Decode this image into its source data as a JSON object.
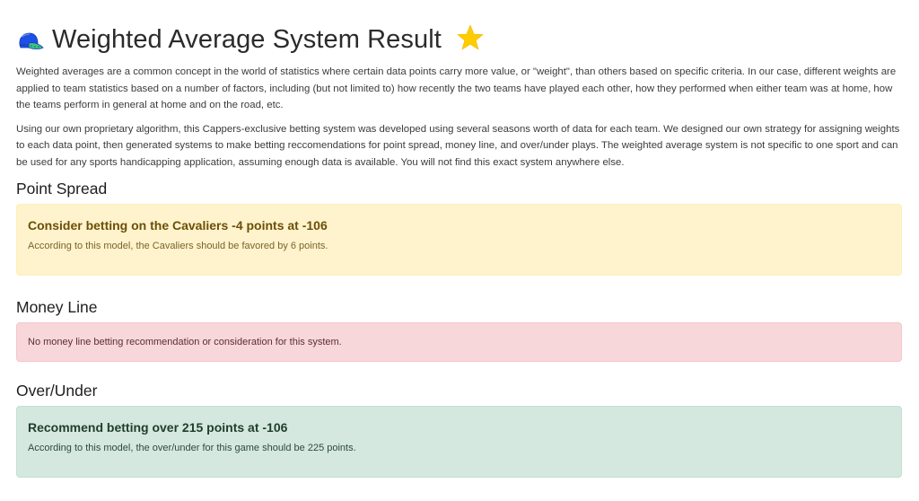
{
  "header": {
    "title": "Weighted Average System Result",
    "leading_icon": "baseball-cap-icon",
    "trailing_icon": "star-icon"
  },
  "intro": {
    "paragraph_1": "Weighted averages are a common concept in the world of statistics where certain data points carry more value, or \"weight\", than others based on specific criteria. In our case, different weights are applied to team statistics based on a number of factors, including (but not limited to) how recently the two teams have played each other, how they performed when either team was at home, how the teams perform in general at home and on the road, etc.",
    "paragraph_2": "Using our own proprietary algorithm, this Cappers-exclusive betting system was developed using several seasons worth of data for each team. We designed our own strategy for assigning weights to each data point, then generated systems to make betting reccomendations for point spread, money line, and over/under plays. The weighted average system is not specific to one sport and can be used for any sports handicapping application, assuming enough data is available. You will not find this exact system anywhere else."
  },
  "sections": {
    "point_spread": {
      "heading": "Point Spread",
      "status": "warning",
      "alert_heading": "Consider betting on the Cavaliers -4 points at -106",
      "alert_text": "According to this model, the Cavaliers should be favored by 6 points."
    },
    "money_line": {
      "heading": "Money Line",
      "status": "danger",
      "alert_text": "No money line betting recommendation or consideration for this system."
    },
    "over_under": {
      "heading": "Over/Under",
      "status": "success",
      "alert_heading": "Recommend betting over 215 points at -106",
      "alert_text": "According to this model, the over/under for this game should be 225 points."
    }
  },
  "colors": {
    "warning_bg": "#fff3cd",
    "danger_bg": "#f8d7da",
    "success_bg": "#d4e8df",
    "star": "#ffcc00",
    "cap": "#2255ee"
  }
}
